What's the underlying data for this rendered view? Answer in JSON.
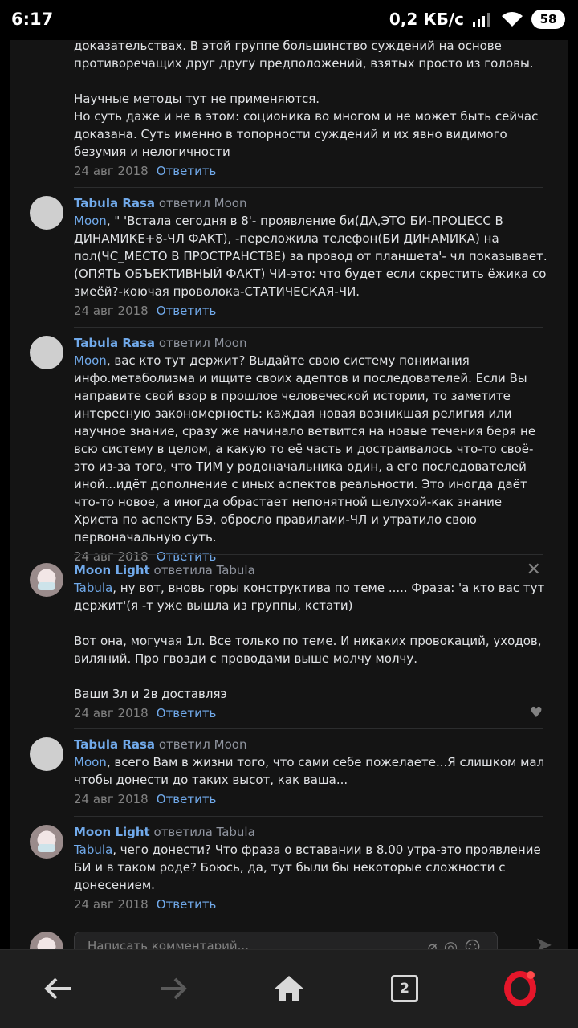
{
  "status_bar": {
    "time": "6:17",
    "speed": "0,2 КБ/с",
    "battery": "58",
    "signal_icon": "signal-icon",
    "wifi_icon": "wifi-icon"
  },
  "comments": [
    {
      "lines": [
        "доказательствах. В этой группе большинство суждений на основе противоречащих друг другу предположений, взятых просто из головы.",
        "",
        "Научные методы тут не применяются.",
        "Но суть даже и не в этом: соционика во многом и не может быть сейчас доказана. Суть именно в топорности суждений и их явно видимого безумия и нелогичности"
      ],
      "date": "24 авг 2018",
      "reply": "Ответить"
    },
    {
      "author": "Tabula Rasa",
      "action": "ответил Moon",
      "mention": "Moon",
      "text": ", \" 'Встала сегодня в 8'- проявление би(ДА,ЭТО БИ-ПРОЦЕСС В ДИНАМИКЕ+8-ЧЛ ФАКТ), -переложила телефон(БИ ДИНАМИКА) на пол(ЧС_МЕСТО В ПРОСТРАНСТВЕ) за провод от планшета'- чл показывает.(ОПЯТЬ ОБЪЕКТИВНЫЙ ФАКТ) ЧИ-это: что будет если скрестить ёжика со змеёй?-коючая проволока-СТАТИЧЕСКАЯ-ЧИ.",
      "date": "24 авг 2018",
      "reply": "Ответить"
    },
    {
      "author": "Tabula Rasa",
      "action": "ответил Moon",
      "mention": "Moon",
      "text": ", вас кто тут держит? Выдайте свою систему понимания инфо.метаболизма и ищите своих адептов и последователей. Если Вы направите свой взор в прошлое человеческой истории, то заметите интересную закономерность: каждая новая возникшая религия или научное знание, сразу же начинало ветвится на новые течения беря не всю систему в целом, а какую то её часть и достраивалось что-то своё-это из-за того, что ТИМ у родоначальника один, а его последователей иной...идёт дополнение с иных аспектов реальности. Это иногда даёт что-то новое, а иногда обрастает непонятной шелухой-как знание Христа по аспекту БЭ, обросло правилами-ЧЛ и утратило свою первоначальную суть.",
      "date": "24 авг 2018",
      "reply": "Ответить"
    },
    {
      "author": "Moon Light",
      "action": "ответила Tabula",
      "mention": "Tabula",
      "text": ", ну вот, вновь горы конструктива по теме ..... Фраза: 'а кто вас тут держит'(я -т уже вышла из группы, кстати)",
      "extra_1": "Вот она, могучая 1л. Все только по теме. И никаких провокаций, уходов, виляний. Про гвозди с проводами выше молчу молчу.",
      "extra_2": "Ваши 3л и 2в доставляэ",
      "date": "24 авг 2018",
      "reply": "Ответить",
      "close_icon": "close-icon",
      "like_icon": "heart-icon"
    },
    {
      "author": "Tabula Rasa",
      "action": "ответил Moon",
      "mention": "Moon",
      "text": ", всего Вам в жизни того, что сами себе пожелаете...Я слишком мал чтобы донести до таких высот, как ваша...",
      "date": "24 авг 2018",
      "reply": "Ответить"
    },
    {
      "author": "Moon Light",
      "action": "ответила Tabula",
      "mention": "Tabula",
      "text": ", чего донести? Что фраза о вставании в 8.00 утра-это проявление БИ и в таком роде? Боюсь, да, тут были бы некоторые сложности с донесением.",
      "date": "24 авг 2018",
      "reply": "Ответить"
    }
  ],
  "compose": {
    "placeholder": "Написать комментарий..."
  },
  "nav": {
    "tabs_count": "2",
    "colors": {
      "opera": "#e5162a",
      "link": "#71aaeb",
      "background": "#141414"
    }
  }
}
